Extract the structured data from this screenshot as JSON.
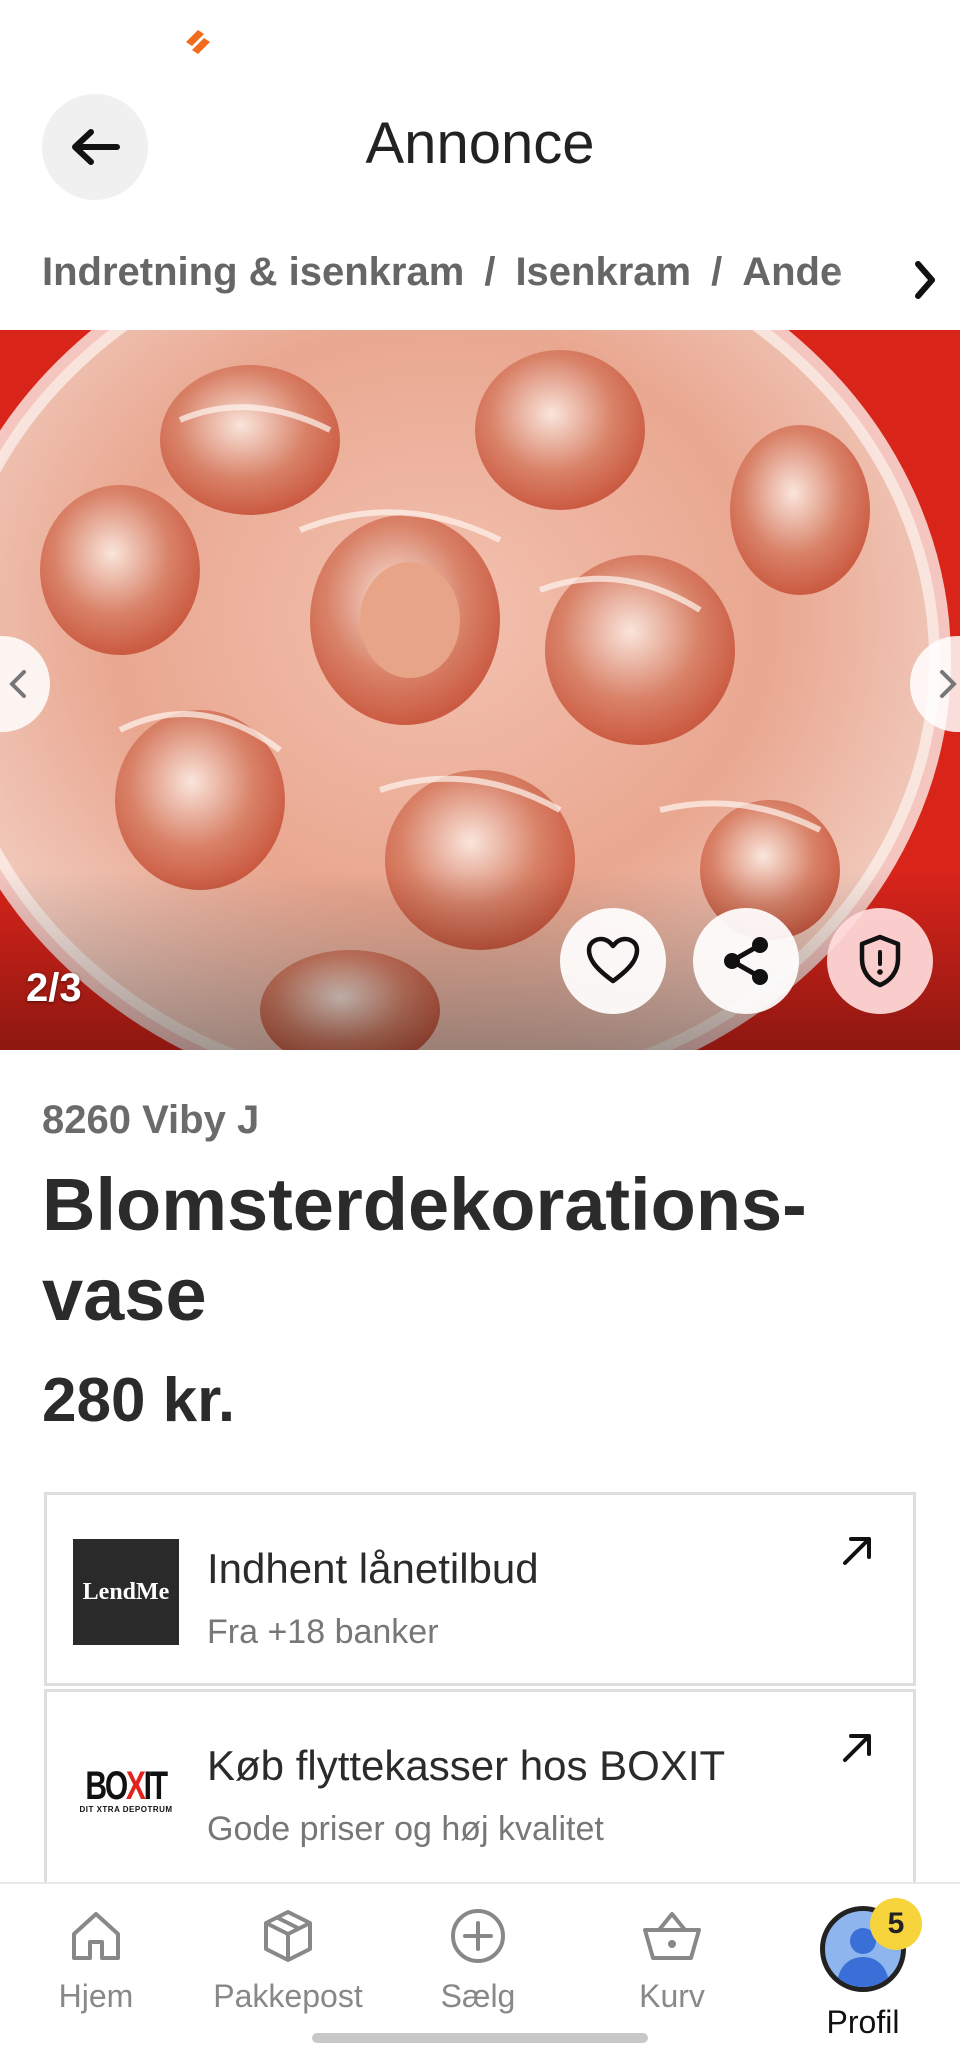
{
  "header": {
    "title": "Annonce",
    "back_icon": "arrow-left-icon"
  },
  "breadcrumb": {
    "items": [
      "Indretning & isenkram",
      "Isenkram",
      "Ande"
    ],
    "separator": "/"
  },
  "gallery": {
    "counter": "2/3",
    "current_index": 2,
    "total": 3,
    "icons": [
      "chevron-left-icon",
      "chevron-right-icon",
      "heart-icon",
      "share-icon",
      "shield-icon"
    ]
  },
  "listing": {
    "location": "8260 Viby J",
    "title": "Blomsterdekorations-vase",
    "title_line1": "Blomsterdekorations-",
    "title_line2": "vase",
    "price": "280 kr."
  },
  "offers": [
    {
      "logo_text": "LendMe",
      "title": "Indhent lånetilbud",
      "subtitle": "Fra +18 banker"
    },
    {
      "logo_text": "BOXIT",
      "logo_tagline": "DIT XTRA DEPOTRUM",
      "title": "Køb flyttekasser hos BOXIT",
      "subtitle": "Gode priser og høj kvalitet"
    }
  ],
  "bottom_nav": {
    "items": [
      {
        "label": "Hjem",
        "icon": "home-icon"
      },
      {
        "label": "Pakkepost",
        "icon": "package-icon"
      },
      {
        "label": "Sælg",
        "icon": "plus-circle-icon"
      },
      {
        "label": "Kurv",
        "icon": "basket-icon"
      },
      {
        "label": "Profil",
        "icon": "avatar-icon"
      }
    ],
    "active": "Profil",
    "profile_badge": "5"
  },
  "colors": {
    "accent": "#f26b1d",
    "text": "#2b2b2b",
    "muted": "#6b6b6b",
    "badge": "#f7d33c",
    "photo_background": "#d9241a"
  }
}
